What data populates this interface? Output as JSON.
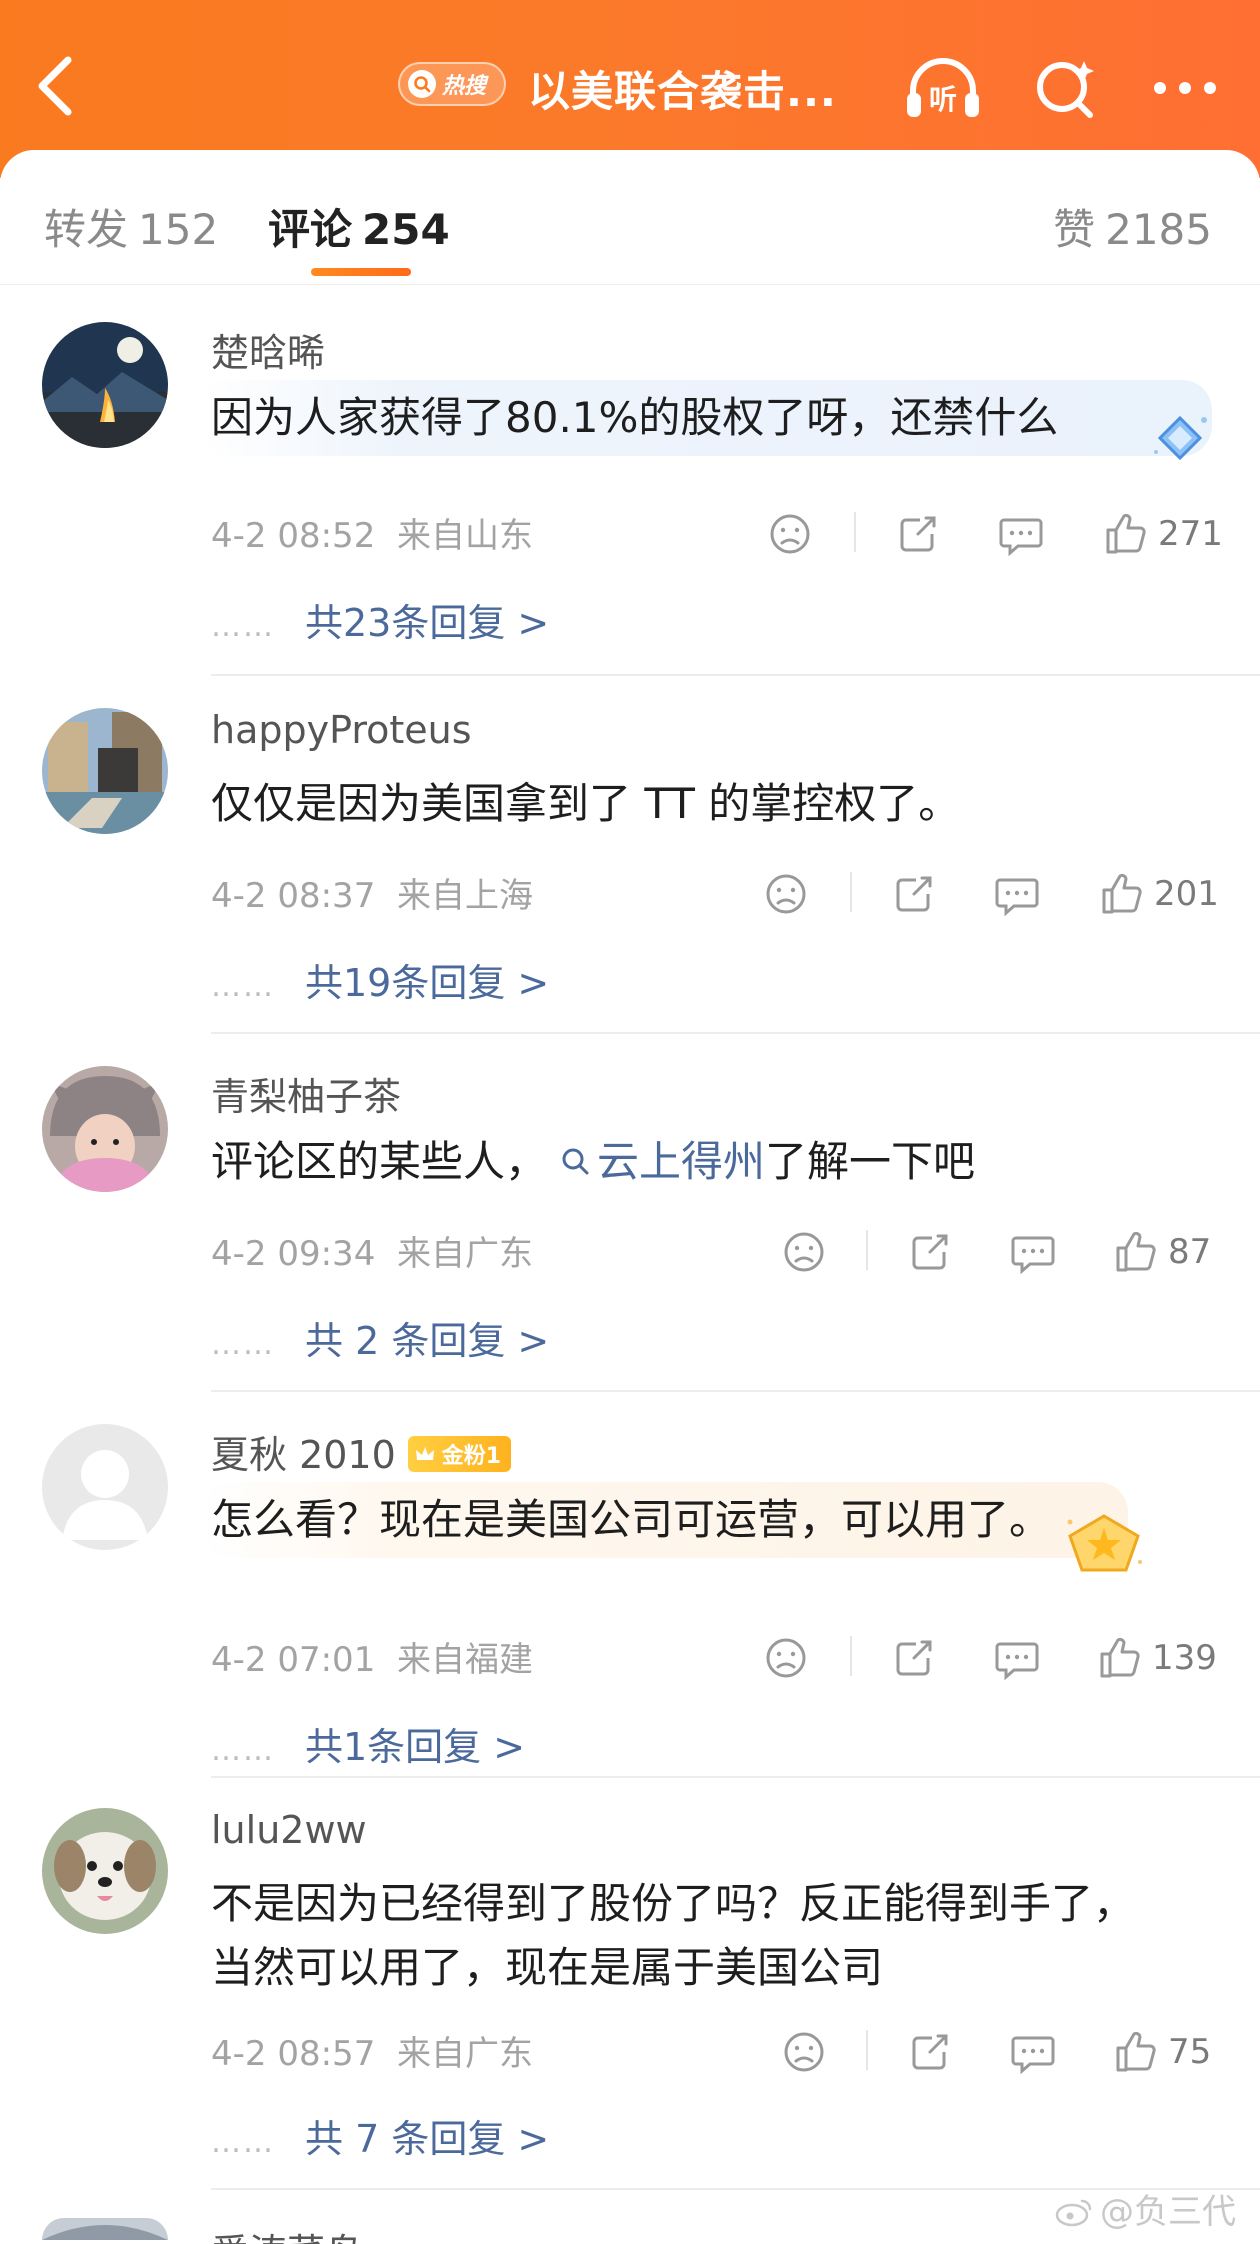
{
  "header": {
    "hot_label": "热搜",
    "title": "以美联合袭击..."
  },
  "tabs": {
    "forward_label": "转发",
    "forward_count": "152",
    "comment_label": "评论",
    "comment_count": "254",
    "like_label": "赞",
    "like_count": "2185"
  },
  "comments": [
    {
      "username": "楚晗晞",
      "text": "因为人家获得了80.1%的股权了呀，还禁什么",
      "time": "4-2 08:52",
      "location": "来自山东",
      "likes": "271",
      "replies": "共23条回复 >"
    },
    {
      "username": "happyProteus",
      "text": "仅仅是因为美国拿到了 TT 的掌控权了。",
      "time": "4-2 08:37",
      "location": "来自上海",
      "likes": "201",
      "replies": "共19条回复 >"
    },
    {
      "username": "青梨柚子茶",
      "text_before": "评论区的某些人，",
      "topic": "云上得州",
      "text_after": "了解一下吧",
      "time": "4-2 09:34",
      "location": "来自广东",
      "likes": "87",
      "replies": "共 2 条回复 >"
    },
    {
      "username": "夏秋 2010",
      "badge": "金粉1",
      "text": "怎么看？现在是美国公司可运营，可以用了。",
      "time": "4-2 07:01",
      "location": "来自福建",
      "likes": "139",
      "replies": "共1条回复 >"
    },
    {
      "username": "lulu2ww",
      "text_line1": "不是因为已经得到了股份了吗？反正能得到手了，",
      "text_line2": "当然可以用了，现在是属于美国公司",
      "time": "4-2 08:57",
      "location": "来自广东",
      "likes": "75",
      "replies": "共 7 条回复 >"
    },
    {
      "username": "爱涛菜鸟"
    }
  ],
  "watermark": "@负三代",
  "colors": {
    "header_orange": "#f97a1f",
    "link_blue": "#4b6a9b",
    "tab_underline": "#ff7a1e"
  }
}
